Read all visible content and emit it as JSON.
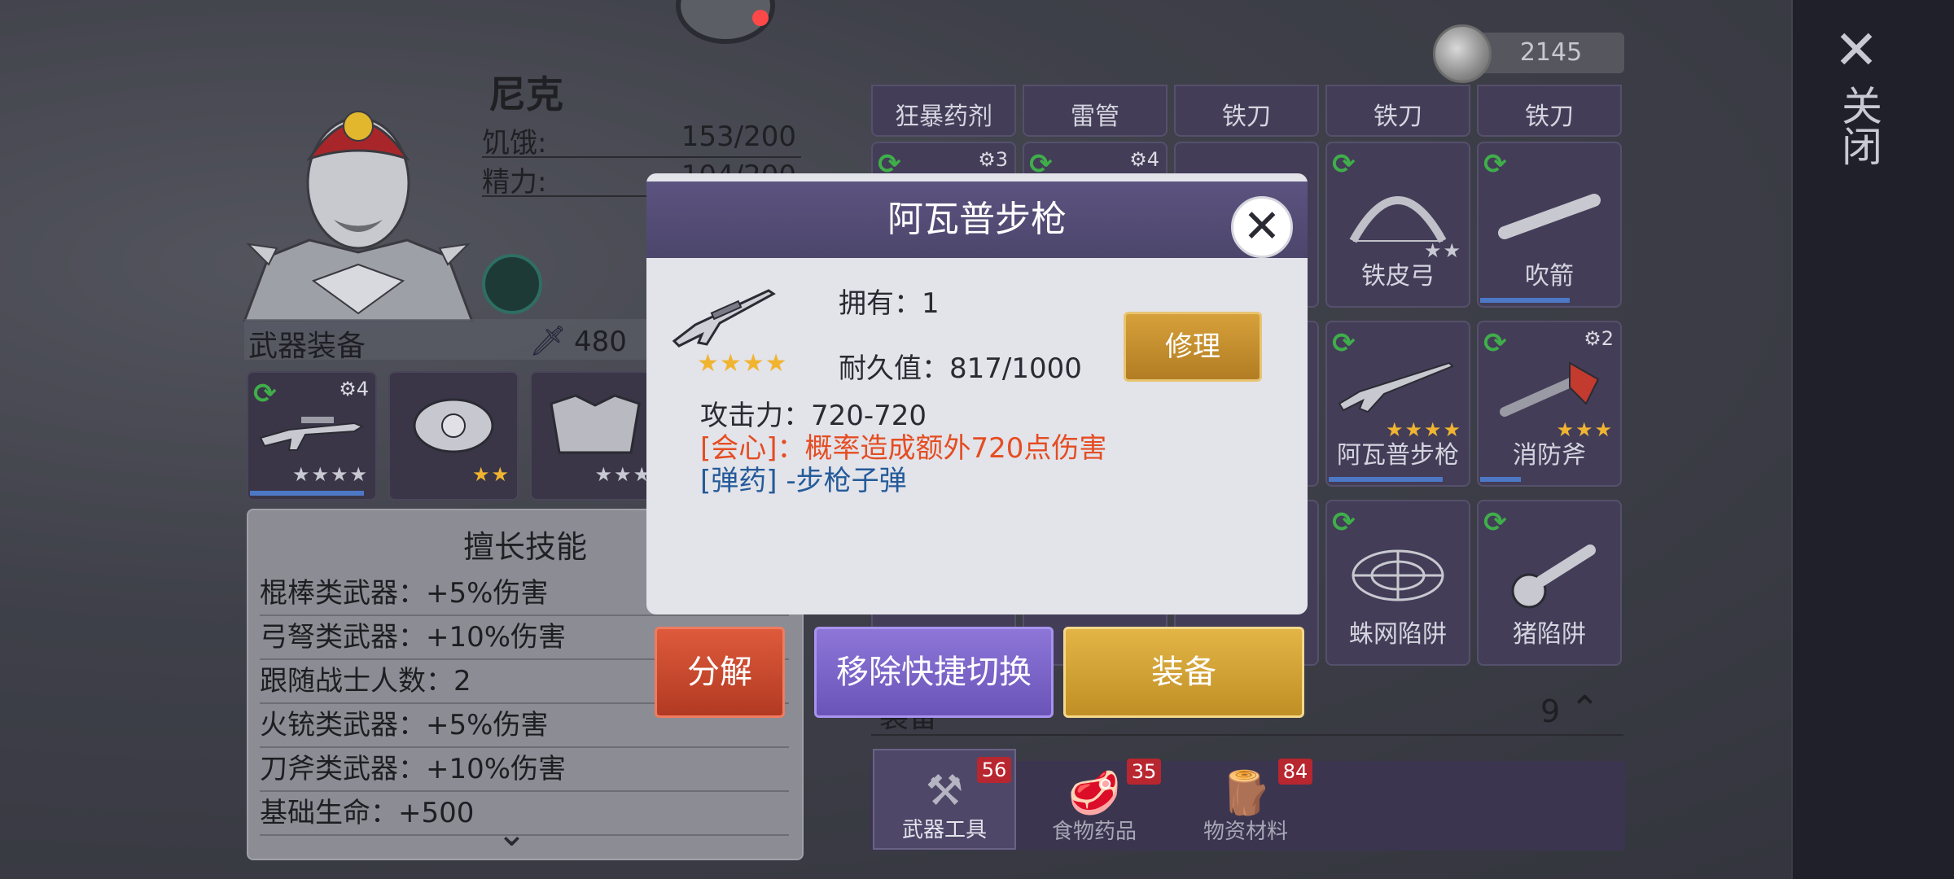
{
  "currency": {
    "value": "2145"
  },
  "close_bar": {
    "label": "关闭"
  },
  "character": {
    "name": "尼克",
    "hunger_label": "饥饿:",
    "hunger_value": "153/200",
    "energy_label": "精力:",
    "energy_value": "104/200"
  },
  "weapon_equipment": {
    "title": "武器装备",
    "power": "480",
    "slots": [
      {
        "icon": "rifle-icon",
        "gear": "4",
        "stars": 4,
        "gold_stars": 0
      },
      {
        "icon": "headband-icon",
        "stars": 2,
        "gold_stars": 2
      },
      {
        "icon": "armor-icon",
        "stars": 3,
        "gold_stars": 0
      }
    ]
  },
  "skills": {
    "title": "擅长技能",
    "items": [
      "棍棒类武器：+5%伤害",
      "弓弩类武器：+10%伤害",
      "跟随战士人数：2",
      "火铳类武器：+5%伤害",
      "刀斧类武器：+10%伤害",
      "基础生命：+500"
    ]
  },
  "inventory": {
    "top_row": [
      "狂暴药剂",
      "雷管",
      "铁刀",
      "铁刀",
      "铁刀"
    ],
    "items": [
      {
        "label": "铁皮弓",
        "icon": "bow-icon"
      },
      {
        "label": "吹箭",
        "icon": "blowpipe-icon"
      },
      {
        "label": "阿瓦普步枪",
        "icon": "sniper-rifle-icon",
        "stars": 4
      },
      {
        "label": "消防斧",
        "icon": "fire-axe-icon",
        "gear": "2",
        "stars": 3
      },
      {
        "label": "蛛网陷阱",
        "icon": "web-trap-icon"
      },
      {
        "label": "猪陷阱",
        "icon": "pig-trap-icon"
      }
    ]
  },
  "popup": {
    "title": "阿瓦普步枪",
    "own_label": "拥有：1",
    "durability": "耐久值：817/1000",
    "repair_label": "修理",
    "attack": "攻击力：720-720",
    "crit": "[会心]：概率造成额外720点伤害",
    "ammo": "[弹药] -步枪子弹",
    "stars": 4
  },
  "buttons": {
    "dismantle": "分解",
    "remove_quick": "移除快捷切换",
    "equip": "装备"
  },
  "equipment_section": {
    "title": "装备",
    "count": "9"
  },
  "tabs": [
    {
      "label": "武器工具",
      "badge": "56",
      "icon": "weapons-tools-icon"
    },
    {
      "label": "食物药品",
      "badge": "35",
      "icon": "food-icon"
    },
    {
      "label": "物资材料",
      "badge": "84",
      "icon": "materials-icon"
    }
  ],
  "colors": {
    "crit_text": "#e44d22",
    "ammo_text": "#245b99",
    "star_gold": "#f0b431",
    "dismantle": "#c8452d",
    "remove": "#7b64c8",
    "equip": "#d1a233"
  }
}
